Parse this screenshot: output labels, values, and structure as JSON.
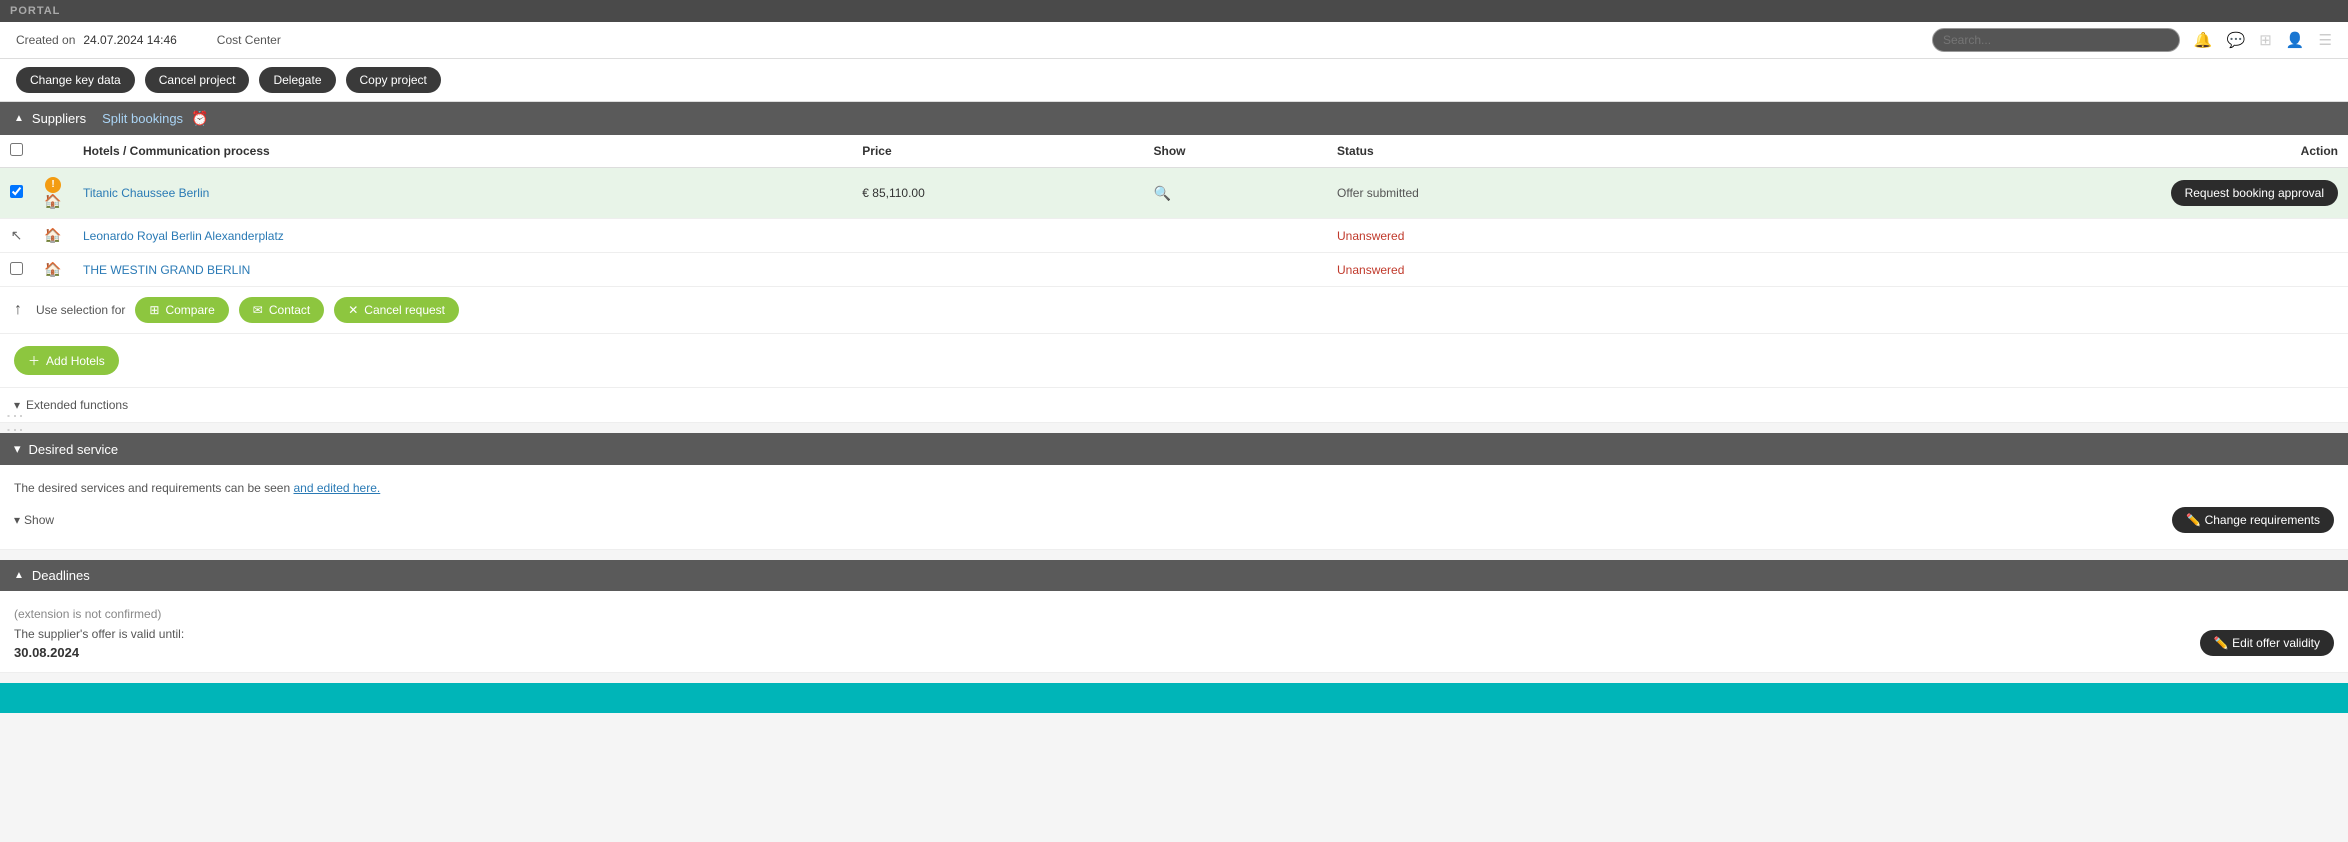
{
  "portal": {
    "label": "PORTAL"
  },
  "header": {
    "created_on_label": "Created on",
    "created_on_value": "24.07.2024 14:46",
    "cost_center_label": "Cost Center"
  },
  "action_bar": {
    "change_key_data": "Change key data",
    "cancel_project": "Cancel project",
    "delegate": "Delegate",
    "copy_project": "Copy project"
  },
  "suppliers_section": {
    "title": "Suppliers",
    "split_bookings": "Split bookings",
    "table": {
      "columns": [
        "Hotels / Communication process",
        "Price",
        "Show",
        "Status",
        "Action"
      ],
      "rows": [
        {
          "id": 1,
          "checked": true,
          "has_warning": true,
          "hotel_name": "Titanic Chaussee Berlin",
          "price": "€ 85,110.00",
          "status": "Offer submitted",
          "action": "Request booking approval",
          "selected": true
        },
        {
          "id": 2,
          "checked": false,
          "has_warning": false,
          "hotel_name": "Leonardo Royal Berlin Alexanderplatz",
          "price": "",
          "status": "Unanswered",
          "action": "",
          "selected": false
        },
        {
          "id": 3,
          "checked": false,
          "has_warning": false,
          "hotel_name": "THE WESTIN GRAND BERLIN",
          "price": "",
          "status": "Unanswered",
          "action": "",
          "selected": false
        }
      ]
    },
    "use_selection_for": "Use selection for",
    "compare_btn": "Compare",
    "contact_btn": "Contact",
    "cancel_request_btn": "Cancel request",
    "add_hotels_btn": "Add Hotels"
  },
  "extended_functions": {
    "label": "Extended functions"
  },
  "desired_service": {
    "title": "Desired service",
    "description": "The desired services and requirements can be seen and edited here.",
    "show_label": "Show",
    "change_requirements_btn": "Change requirements"
  },
  "deadlines": {
    "title": "Deadlines",
    "extension_note": "(extension is not confirmed)",
    "valid_until_label": "The supplier's offer is valid until:",
    "valid_until_date": "30.08.2024",
    "edit_validity_btn": "Edit offer validity"
  }
}
